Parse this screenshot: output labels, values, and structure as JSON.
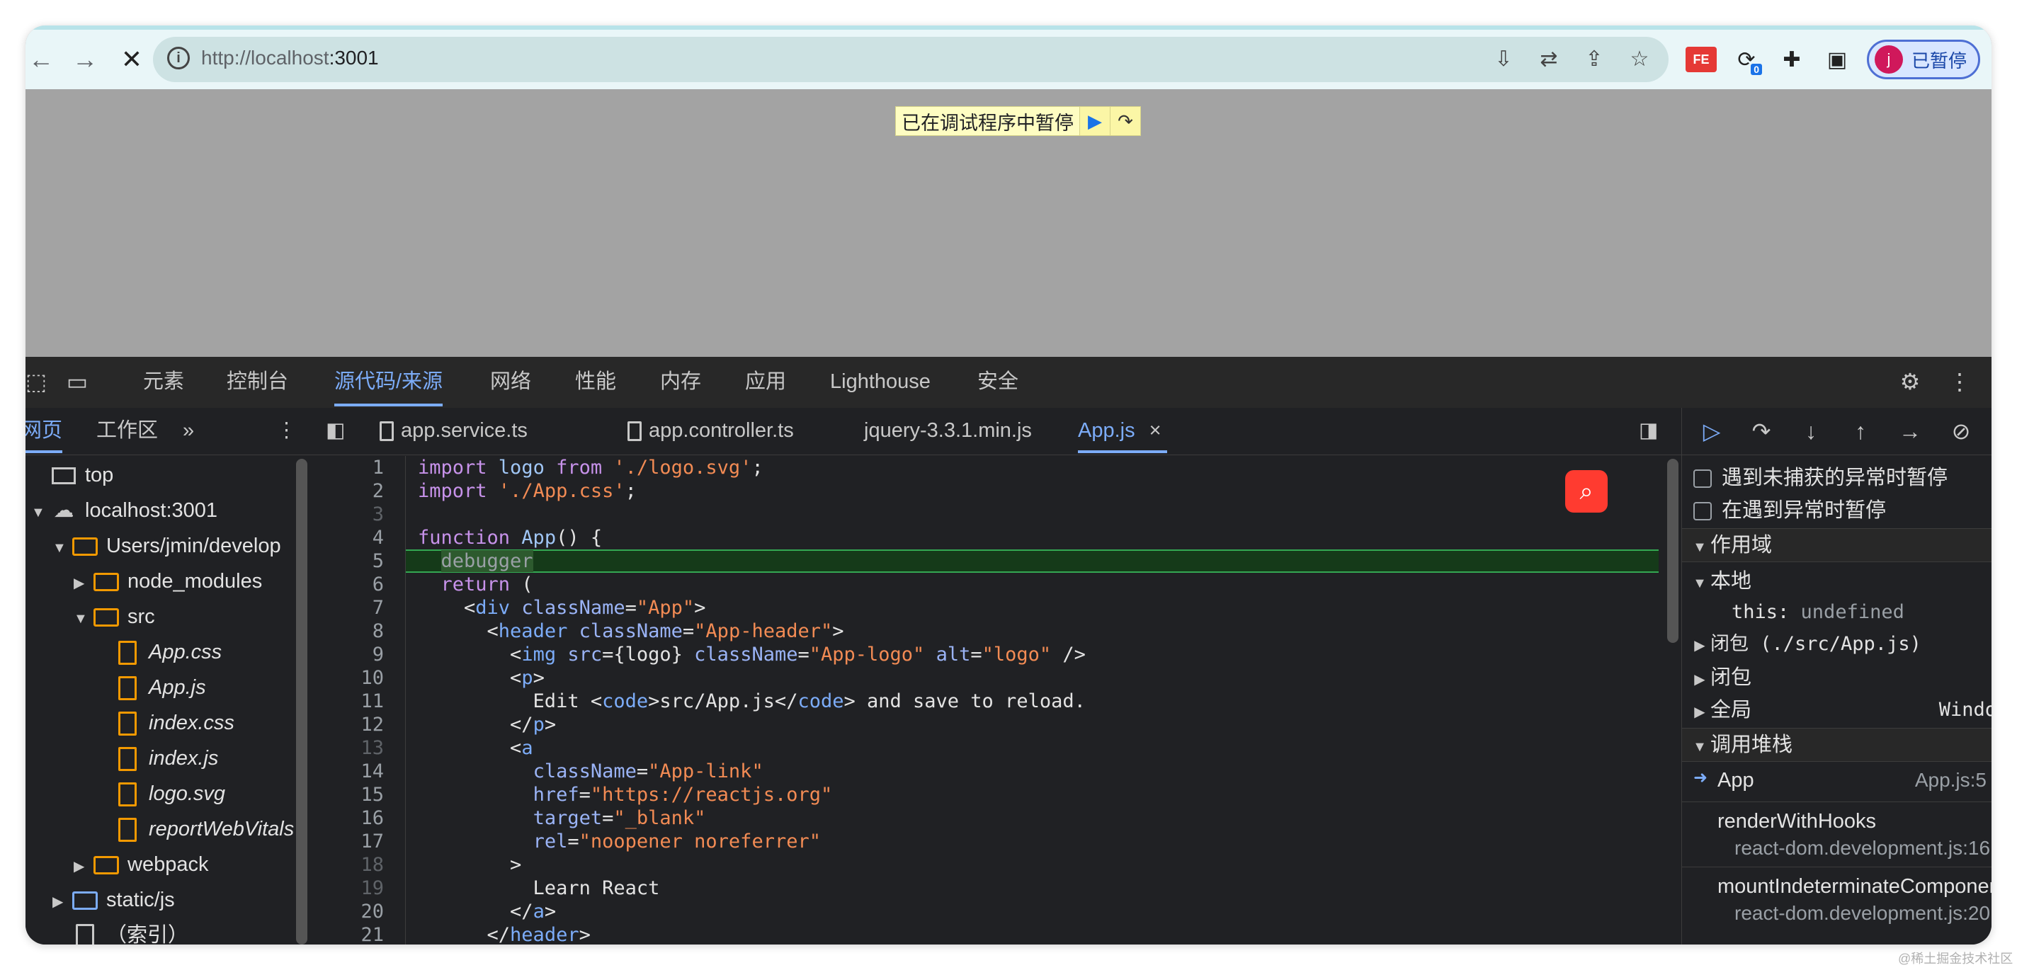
{
  "browser": {
    "url_host": "http://localhost",
    "url_port": ":3001",
    "profile_initial": "j",
    "profile_label": "已暂停",
    "extension_badge": "0",
    "fe_badge": "FE"
  },
  "page": {
    "paused_text": "已在调试程序中暂停"
  },
  "devtools": {
    "tabs": [
      "元素",
      "控制台",
      "源代码/来源",
      "网络",
      "性能",
      "内存",
      "应用",
      "Lighthouse",
      "安全"
    ],
    "active_tab_index": 2,
    "navigator": {
      "tabs": [
        "网页",
        "工作区"
      ],
      "more": "»",
      "tree": [
        {
          "label": "top",
          "depth": 0,
          "icon": "frame"
        },
        {
          "label": "localhost:3001",
          "depth": 0,
          "icon": "cloud",
          "expanded": true
        },
        {
          "label": "Users/jmin/develop",
          "depth": 1,
          "icon": "folder",
          "expanded": true
        },
        {
          "label": "node_modules",
          "depth": 2,
          "icon": "folder",
          "expanded": false
        },
        {
          "label": "src",
          "depth": 2,
          "icon": "folder",
          "expanded": true
        },
        {
          "label": "App.css",
          "depth": 3,
          "icon": "file"
        },
        {
          "label": "App.js",
          "depth": 3,
          "icon": "file"
        },
        {
          "label": "index.css",
          "depth": 3,
          "icon": "file"
        },
        {
          "label": "index.js",
          "depth": 3,
          "icon": "file"
        },
        {
          "label": "logo.svg",
          "depth": 3,
          "icon": "file"
        },
        {
          "label": "reportWebVitals",
          "depth": 3,
          "icon": "file"
        },
        {
          "label": "webpack",
          "depth": 2,
          "icon": "folder",
          "expanded": false
        },
        {
          "label": "static/js",
          "depth": 1,
          "icon": "folder-blue",
          "expanded": false
        },
        {
          "label": "（索引）",
          "depth": 1,
          "icon": "file-white"
        }
      ]
    },
    "editor_tabs": [
      {
        "label": "app.service.ts",
        "active": false
      },
      {
        "label": "app.controller.ts",
        "active": false
      },
      {
        "label": "jquery-3.3.1.min.js",
        "active": false
      },
      {
        "label": "App.js",
        "active": true,
        "close": "×"
      }
    ],
    "code_lines": [
      "1",
      "2",
      "3",
      "4",
      "5",
      "6",
      "7",
      "8",
      "9",
      "10",
      "11",
      "12",
      "13",
      "14",
      "15",
      "16",
      "17",
      "18",
      "19",
      "20",
      "21"
    ],
    "code": {
      "l1_a": "import",
      "l1_b": " logo ",
      "l1_c": "from",
      "l1_d": " './logo.svg'",
      "l1_e": ";",
      "l2_a": "import",
      "l2_b": " './App.css'",
      "l2_c": ";",
      "l4_a": "function",
      "l4_b": " App",
      "l4_c": "() {",
      "l5_a": "  ",
      "l5_b": "debugger",
      "l6_a": "  ",
      "l6_b": "return",
      "l6_c": " (",
      "l7_a": "    <",
      "l7_b": "div",
      "l7_c": " className",
      "l7_d": "=",
      "l7_e": "\"App\"",
      "l7_f": ">",
      "l8_a": "      <",
      "l8_b": "header",
      "l8_c": " className",
      "l8_d": "=",
      "l8_e": "\"App-header\"",
      "l8_f": ">",
      "l9_a": "        <",
      "l9_b": "img",
      "l9_c": " src",
      "l9_d": "={logo} ",
      "l9_e": "className",
      "l9_f": "=",
      "l9_g": "\"App-logo\"",
      "l9_h": " alt",
      "l9_i": "=",
      "l9_j": "\"logo\"",
      "l9_k": " />",
      "l10_a": "        <",
      "l10_b": "p",
      "l10_c": ">",
      "l11_a": "          Edit <",
      "l11_b": "code",
      "l11_c": ">src/App.js</",
      "l11_d": "code",
      "l11_e": "> and save to reload.",
      "l12_a": "        </",
      "l12_b": "p",
      "l12_c": ">",
      "l13_a": "        <",
      "l13_b": "a",
      "l14_a": "          ",
      "l14_b": "className",
      "l14_c": "=",
      "l14_d": "\"App-link\"",
      "l15_a": "          ",
      "l15_b": "href",
      "l15_c": "=",
      "l15_d": "\"https://reactjs.org\"",
      "l16_a": "          ",
      "l16_b": "target",
      "l16_c": "=",
      "l16_d": "\"_blank\"",
      "l17_a": "          ",
      "l17_b": "rel",
      "l17_c": "=",
      "l17_d": "\"noopener noreferrer\"",
      "l18_a": "        >",
      "l19_a": "          Learn React",
      "l20_a": "        </",
      "l20_b": "a",
      "l20_c": ">",
      "l21_a": "      </",
      "l21_b": "header",
      "l21_c": ">"
    },
    "sidebar": {
      "pause_uncaught": "遇到未捕获的异常时暂停",
      "pause_caught": "在遇到异常时暂停",
      "scope_title": "作用域",
      "local_title": "本地",
      "this_key": "this",
      "this_sep": ": ",
      "this_value": "undefined",
      "closure_file": "闭包 (./src/App.js)",
      "closure": "闭包",
      "global": "全局",
      "global_value": "Windo",
      "callstack_title": "调用堆栈",
      "frames": [
        {
          "name": "App",
          "loc": "App.js:5",
          "current": true
        },
        {
          "name": "renderWithHooks",
          "loc": "react-dom.development.js:16"
        },
        {
          "name": "mountIndeterminateComponent",
          "loc": "react-dom.development.js:20"
        }
      ]
    }
  },
  "watermark": "@稀土掘金技术社区",
  "colors": {
    "accent": "#7cacf8",
    "devtools_bg": "#202124",
    "paused_bg": "#fefdc2",
    "exec_line": "#153a19",
    "folder": "#f29900"
  }
}
